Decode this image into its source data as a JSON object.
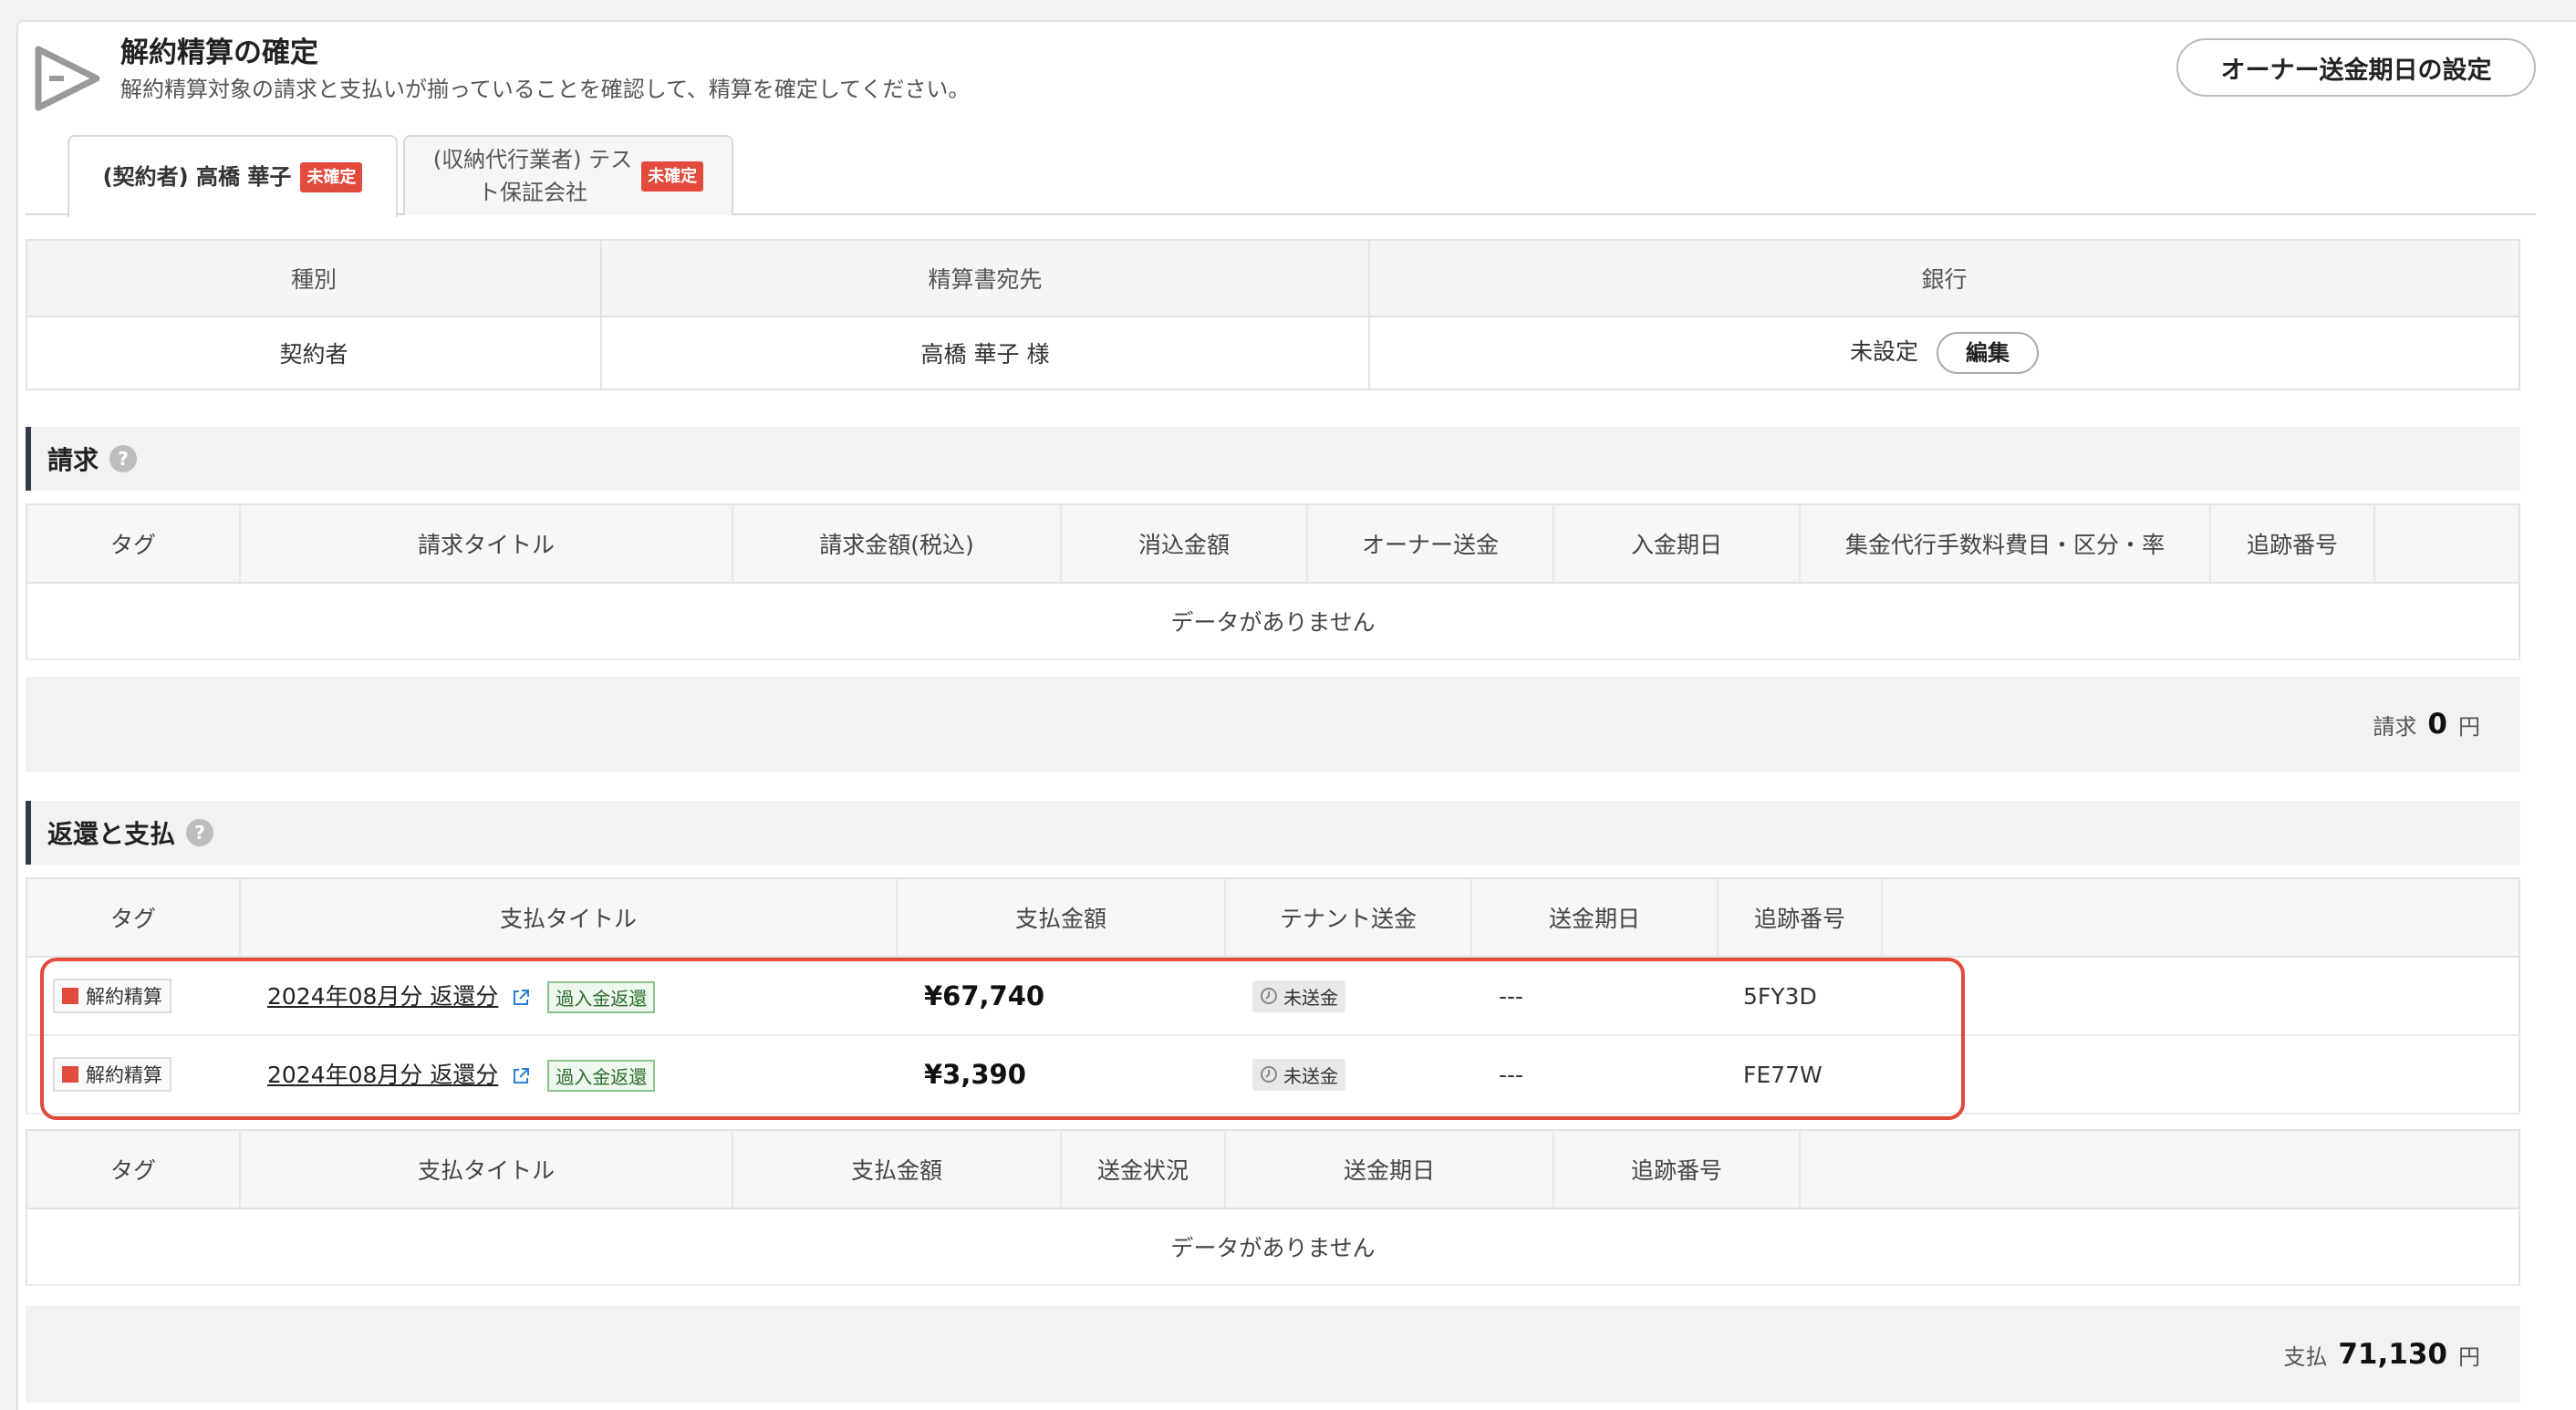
{
  "header": {
    "title": "解約精算の確定",
    "description": "解約精算対象の請求と支払いが揃っていることを確認して、精算を確定してください。",
    "owner_button": "オーナー送金期日の設定"
  },
  "tabs": [
    {
      "label": "(契約者) 高橋 華子",
      "badge": "未確定",
      "active": true
    },
    {
      "label_line1": "(収納代行業者) テス",
      "label_line2": "ト保証会社",
      "badge": "未確定",
      "active": false
    }
  ],
  "info_table": {
    "headers": [
      "種別",
      "精算書宛先",
      "銀行"
    ],
    "row": {
      "type": "契約者",
      "recipient": "高橋 華子 様",
      "bank": "未設定",
      "edit": "編集"
    }
  },
  "billing": {
    "title": "請求",
    "headers": [
      "タグ",
      "請求タイトル",
      "請求金額(税込)",
      "消込金額",
      "オーナー送金",
      "入金期日",
      "集金代行手数料費目・区分・率",
      "追跡番号"
    ],
    "empty": "データがありません",
    "total_label": "請求",
    "total_value": "0",
    "total_unit": "円"
  },
  "refund": {
    "title": "返還と支払",
    "headers": [
      "タグ",
      "支払タイトル",
      "支払金額",
      "テナント送金",
      "送金期日",
      "追跡番号"
    ],
    "rows": [
      {
        "tag": "解約精算",
        "title": "2024年08月分 返還分",
        "category": "過入金返還",
        "amount": "¥67,740",
        "status": "未送金",
        "due": "---",
        "tracking": "5FY3D"
      },
      {
        "tag": "解約精算",
        "title": "2024年08月分 返還分",
        "category": "過入金返還",
        "amount": "¥3,390",
        "status": "未送金",
        "due": "---",
        "tracking": "FE77W"
      }
    ],
    "payment_headers": [
      "タグ",
      "支払タイトル",
      "支払金額",
      "送金状況",
      "送金期日",
      "追跡番号"
    ],
    "empty": "データがありません",
    "total_label": "支払",
    "total_value": "71,130",
    "total_unit": "円"
  },
  "colors": {
    "accent_red": "#e24a3b",
    "section_bar": "#333c4e"
  }
}
